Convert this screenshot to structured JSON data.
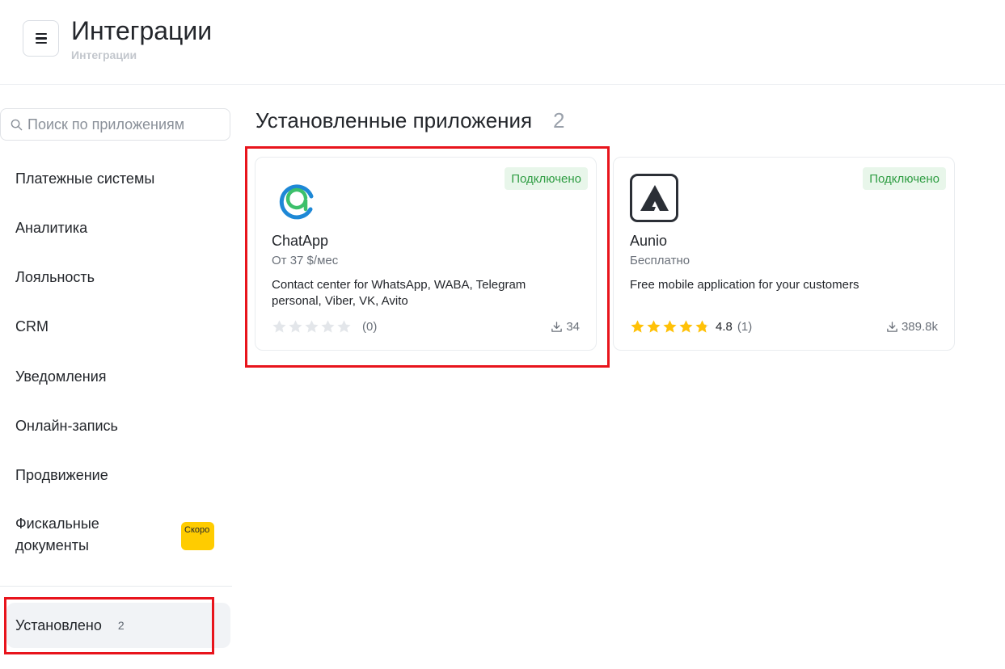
{
  "header": {
    "title": "Интеграции",
    "breadcrumb": "Интеграции"
  },
  "sidebar": {
    "search_placeholder": "Поиск по приложениям",
    "categories": [
      "Платежные системы",
      "Аналитика",
      "Лояльность",
      "CRM",
      "Уведомления",
      "Онлайн-запись",
      "Продвижение",
      "Фискальные документы"
    ],
    "soon_badge": "Скоро",
    "installed": {
      "label": "Установлено",
      "count": "2"
    }
  },
  "main": {
    "section_title": "Установленные приложения",
    "section_count": "2",
    "apps": [
      {
        "name": "ChatApp",
        "price": "От 37 $/мес",
        "description": "Contact center for WhatsApp, WABA, Telegram personal, Viber, VK, Avito",
        "status": "Подключено",
        "stars_filled": 0,
        "rating_value": "",
        "rating_count": "(0)",
        "downloads": "34",
        "logo_icon": "chatapp-logo-icon"
      },
      {
        "name": "Aunio",
        "price": "Бесплатно",
        "description": "Free mobile application for your customers",
        "status": "Подключено",
        "stars_filled": 4.8,
        "rating_value": "4.8",
        "rating_count": "(1)",
        "downloads": "389.8k",
        "logo_icon": "aunio-logo-icon"
      }
    ]
  },
  "colors": {
    "status_bg": "#e8f6ea",
    "status_text": "#2f9d43",
    "star_filled": "#ffc107",
    "star_empty": "#e3e6ea",
    "soon_badge": "#ffcc00",
    "highlight": "#e8141c"
  }
}
